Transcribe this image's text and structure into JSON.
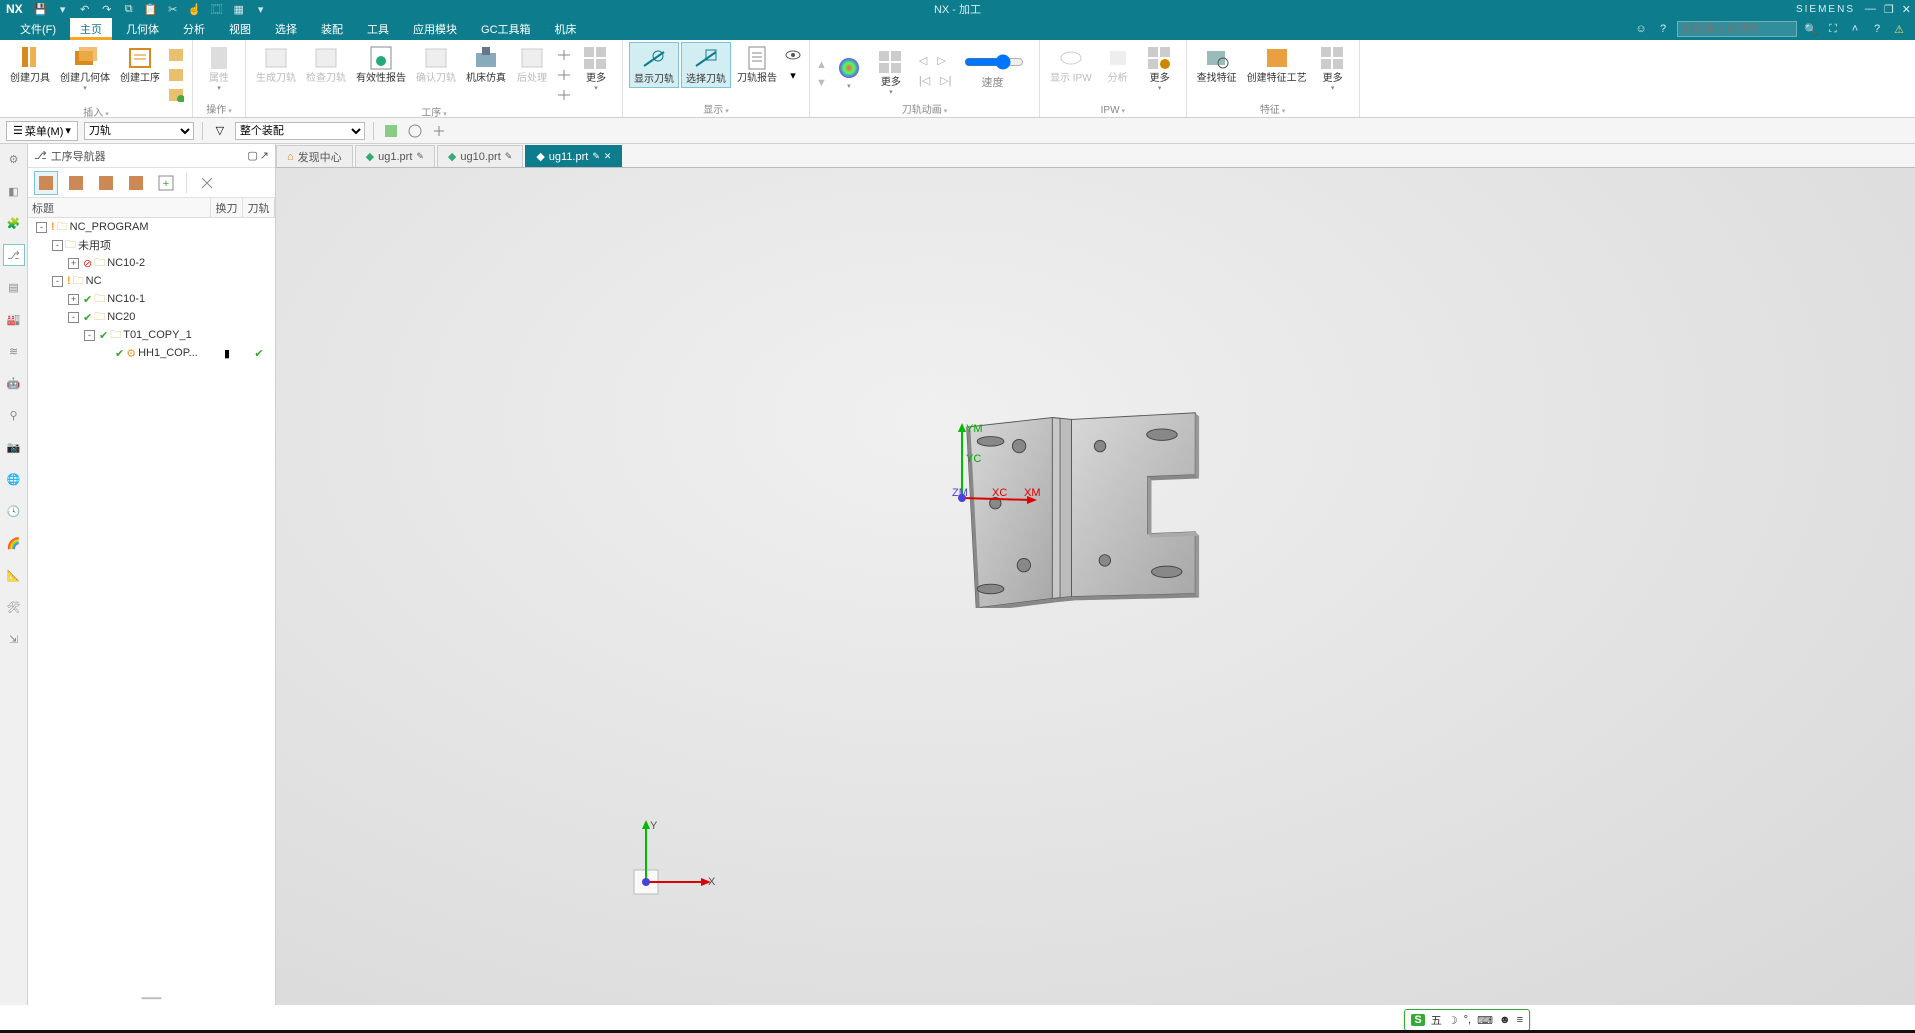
{
  "title_bar": {
    "logo": "NX",
    "qat_icons": [
      "save-icon",
      "dropdown-icon",
      "undo-icon",
      "redo-icon",
      "copy-icon",
      "paste-icon",
      "cut-icon",
      "touch-icon",
      "window-icon",
      "layout-icon",
      "dropdown-icon"
    ],
    "app_title": "NX - 加工",
    "siemens": "SIEMENS",
    "win": {
      "min": "—",
      "max": "❐",
      "close": "✕"
    }
  },
  "menu": {
    "items": [
      "文件(F)",
      "主页",
      "几何体",
      "分析",
      "视图",
      "选择",
      "装配",
      "工具",
      "应用模块",
      "GC工具箱",
      "机床"
    ],
    "active_index": 1,
    "search_placeholder": "在此输入以搜索",
    "right_icons": [
      "smile-icon",
      "help-icon"
    ],
    "far_icons": [
      "fullscreen-icon",
      "up-icon",
      "help2-icon",
      "warn-icon"
    ]
  },
  "ribbon": {
    "groups": [
      {
        "label": "插入",
        "buttons": [
          {
            "name": "create-tool",
            "label": "创建刀具",
            "icon": "#d88a1e"
          },
          {
            "name": "create-geom",
            "label": "创建几何体",
            "icon": "#d88a1e",
            "drop": true
          },
          {
            "name": "create-op",
            "label": "创建工序",
            "icon": "#d88a1e"
          }
        ],
        "extras": true
      },
      {
        "label": "操作",
        "buttons": [
          {
            "name": "props",
            "label": "属性",
            "icon": "#bbb",
            "disabled": true
          }
        ]
      },
      {
        "label": "工序",
        "buttons": [
          {
            "name": "gen-path",
            "label": "生成刀轨",
            "icon": "#bbb",
            "disabled": true
          },
          {
            "name": "check-path",
            "label": "检查刀轨",
            "icon": "#bbb",
            "disabled": true
          },
          {
            "name": "eff-report",
            "label": "有效性报告",
            "icon": "#555"
          },
          {
            "name": "confirm-path",
            "label": "确认刀轨",
            "icon": "#bbb",
            "disabled": true
          },
          {
            "name": "machine-sim",
            "label": "机床仿真",
            "icon": "#555"
          },
          {
            "name": "post",
            "label": "后处理",
            "icon": "#bbb",
            "disabled": true
          },
          {
            "name": "more-op",
            "label": "更多",
            "icon": "#777",
            "drop": true
          }
        ]
      },
      {
        "label": "显示",
        "buttons": [
          {
            "name": "show-path",
            "label": "显示刀轨",
            "icon": "#0d7c8c",
            "sel": true
          },
          {
            "name": "select-path",
            "label": "选择刀轨",
            "icon": "#0d7c8c",
            "sel": true
          },
          {
            "name": "path-report",
            "label": "刀轨报告",
            "icon": "#555"
          }
        ],
        "extras_eye": true
      },
      {
        "label": "刀轨动画",
        "buttons": [],
        "nav": true,
        "more": {
          "name": "more-anim",
          "label": "更多"
        },
        "speed_label": "速度"
      },
      {
        "label": "IPW",
        "buttons": [
          {
            "name": "show-ipw",
            "label": "显示 IPW",
            "icon": "#bbb",
            "disabled": true
          },
          {
            "name": "analyze",
            "label": "分析",
            "icon": "#bbb",
            "disabled": true
          },
          {
            "name": "more-ipw",
            "label": "更多",
            "icon": "#777",
            "drop": true
          }
        ]
      },
      {
        "label": "特征",
        "buttons": [
          {
            "name": "find-feat",
            "label": "查找特征",
            "icon": "#8aa"
          },
          {
            "name": "create-feat-proc",
            "label": "创建特征工艺",
            "icon": "#c80"
          },
          {
            "name": "more-feat",
            "label": "更多",
            "icon": "#777",
            "drop": true
          }
        ]
      }
    ]
  },
  "sel_bar": {
    "menu_btn": "菜单(M)",
    "dd1": "刀轨",
    "dd2": "整个装配",
    "icons": [
      "filter-icon"
    ],
    "right_icons": [
      "g1-icon",
      "g2-icon",
      "g3-icon"
    ]
  },
  "left_rail": {
    "items": [
      "gear-icon",
      "cube-icon",
      "part-icon",
      "ops-nav-icon",
      "sheet-icon",
      "mach-icon",
      "wire-icon",
      "robot-icon",
      "probe-icon",
      "cam-icon",
      "world-icon",
      "clock-icon",
      "rainbow-icon",
      "dim-icon",
      "tool-icon",
      "export-icon"
    ],
    "active_index": 3
  },
  "nav": {
    "title": "工序导航器",
    "toolbar_active": 0,
    "cols": {
      "title": "标题",
      "c2": "换刀",
      "c3": "刀轨"
    },
    "tree": [
      {
        "level": 0,
        "exp": "-",
        "pre": "vbar",
        "icon": "folder",
        "label": "NC_PROGRAM"
      },
      {
        "level": 1,
        "exp": "-",
        "pre": "",
        "icon": "folder",
        "label": "未用项"
      },
      {
        "level": 2,
        "exp": "+",
        "pre": "blk",
        "icon": "folder",
        "label": "NC10-2"
      },
      {
        "level": 1,
        "exp": "-",
        "pre": "vbar",
        "icon": "folder",
        "label": "NC"
      },
      {
        "level": 2,
        "exp": "+",
        "pre": "chk",
        "icon": "folder",
        "label": "NC10-1"
      },
      {
        "level": 2,
        "exp": "-",
        "pre": "chk",
        "icon": "folder",
        "label": "NC20"
      },
      {
        "level": 3,
        "exp": "-",
        "pre": "chk",
        "icon": "folder",
        "label": "T01_COPY_1"
      },
      {
        "level": 4,
        "exp": "",
        "pre": "chk",
        "icon": "op",
        "label": "HH1_COP...",
        "c2": "▮",
        "c3": "✔"
      }
    ]
  },
  "doc_tabs": {
    "items": [
      {
        "label": "发现中心",
        "icon": "home"
      },
      {
        "label": "ug1.prt",
        "icon": "part",
        "mod": true
      },
      {
        "label": "ug10.prt",
        "icon": "part",
        "mod": true
      },
      {
        "label": "ug11.prt",
        "icon": "part",
        "mod": true,
        "active": true,
        "close": true
      }
    ]
  },
  "viewport": {
    "axes": {
      "x": "X",
      "y": "Y",
      "xm": "XM",
      "ym": "YM",
      "xc": "XC",
      "yc": "YC",
      "zm": "ZM"
    }
  },
  "ime": {
    "logo": "S",
    "text": "五",
    "icons": [
      "moon-icon",
      "comma-icon",
      "kbd-icon",
      "face-icon",
      "menu-icon"
    ]
  }
}
